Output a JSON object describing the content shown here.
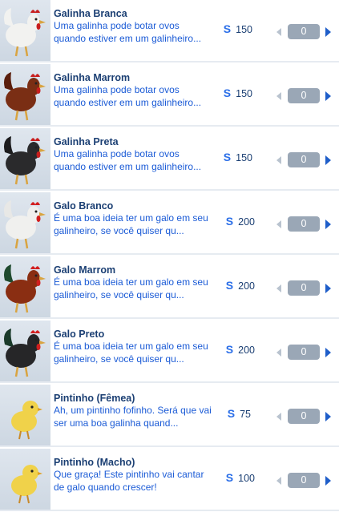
{
  "currency_symbol": "S",
  "items": [
    {
      "name": "Galinha Branca",
      "desc": "Uma galinha pode botar ovos quando estiver em um galinheiro...",
      "price": "150",
      "qty": "0",
      "body_color": "#f2f2f0",
      "comb_color": "#c81e1e",
      "tail_color": "#f2f2f0"
    },
    {
      "name": "Galinha Marrom",
      "desc": "Uma galinha pode botar ovos quando estiver em um galinheiro...",
      "price": "150",
      "qty": "0",
      "body_color": "#7a2e14",
      "comb_color": "#c81e1e",
      "tail_color": "#5a1e0c"
    },
    {
      "name": "Galinha Preta",
      "desc": "Uma galinha pode botar ovos quando estiver em um galinheiro...",
      "price": "150",
      "qty": "0",
      "body_color": "#2a2a2c",
      "comb_color": "#c81e1e",
      "tail_color": "#1c1c1e"
    },
    {
      "name": "Galo Branco",
      "desc": "É uma boa ideia ter um galo em seu galinheiro, se você quiser qu...",
      "price": "200",
      "qty": "0",
      "body_color": "#f0f0ee",
      "comb_color": "#d21f1f",
      "tail_color": "#e8e8e6"
    },
    {
      "name": "Galo Marrom",
      "desc": "É uma boa ideia ter um galo em seu galinheiro, se você quiser qu...",
      "price": "200",
      "qty": "0",
      "body_color": "#8a2e12",
      "comb_color": "#d21f1f",
      "tail_color": "#1f4a2e"
    },
    {
      "name": "Galo Preto",
      "desc": "É uma boa ideia ter um galo em seu galinheiro, se você quiser qu...",
      "price": "200",
      "qty": "0",
      "body_color": "#262628",
      "comb_color": "#d21f1f",
      "tail_color": "#1a3a2a"
    },
    {
      "name": "Pintinho (Fêmea)",
      "desc": "Ah, um pintinho fofinho. Será que vai ser uma boa galinha quand...",
      "price": "75",
      "qty": "0",
      "body_color": "#f0d24a",
      "comb_color": "#e0a020",
      "tail_color": "#f0d24a"
    },
    {
      "name": "Pintinho (Macho)",
      "desc": "Que graça! Este pintinho vai cantar de galo quando crescer!",
      "price": "100",
      "qty": "0",
      "body_color": "#f0d24a",
      "comb_color": "#e0a020",
      "tail_color": "#f0d24a"
    }
  ]
}
